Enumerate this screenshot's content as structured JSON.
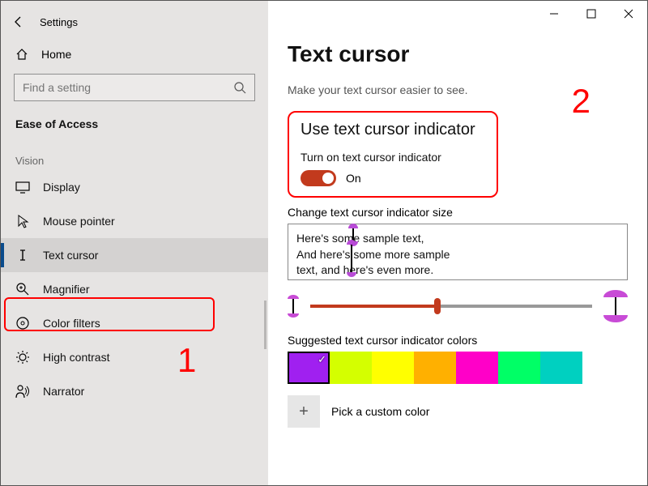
{
  "window": {
    "title": "Settings"
  },
  "sidebar": {
    "home": "Home",
    "search_placeholder": "Find a setting",
    "section": "Ease of Access",
    "group": "Vision",
    "items": [
      {
        "label": "Display"
      },
      {
        "label": "Mouse pointer"
      },
      {
        "label": "Text cursor"
      },
      {
        "label": "Magnifier"
      },
      {
        "label": "Color filters"
      },
      {
        "label": "High contrast"
      },
      {
        "label": "Narrator"
      }
    ]
  },
  "main": {
    "title": "Text cursor",
    "subtitle": "Make your text cursor easier to see.",
    "indicator": {
      "heading": "Use text cursor indicator",
      "toggle_label": "Turn on text cursor indicator",
      "toggle_state": "On"
    },
    "size_label": "Change text cursor indicator size",
    "preview": {
      "line1": "Here's some sample text,",
      "line2": "And here's some more sample",
      "line3": "text, and here's even more."
    },
    "suggested_colors_label": "Suggested text cursor indicator colors",
    "colors": [
      "#a020f0",
      "#d4ff00",
      "#ffff00",
      "#ffb000",
      "#ff00c8",
      "#00ff66",
      "#00d0c0"
    ],
    "custom_color_label": "Pick a custom color"
  },
  "annotations": {
    "one": "1",
    "two": "2"
  }
}
